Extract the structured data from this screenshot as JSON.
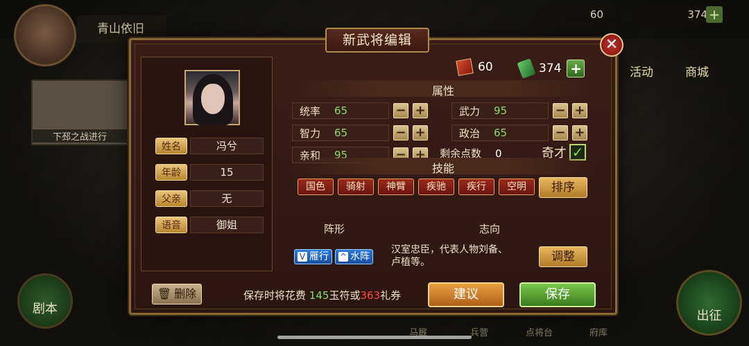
{
  "background": {
    "player_name": "青山依旧",
    "resource_a": "60",
    "resource_b": "374",
    "campaign_label": "下邳之战进行",
    "menu_activity": "活动",
    "menu_shop": "商城",
    "left_button": "剧本",
    "right_button": "出征",
    "bottom_labels": [
      "马厩",
      "兵营",
      "点将台",
      "府库"
    ]
  },
  "dialog": {
    "title": "新武将编辑",
    "close_icon": "close-icon",
    "resources": {
      "tally": "60",
      "jade": "374"
    },
    "profile": {
      "fields": [
        {
          "label": "姓名",
          "value": "冯兮"
        },
        {
          "label": "年龄",
          "value": "15"
        },
        {
          "label": "父亲",
          "value": "无"
        },
        {
          "label": "语音",
          "value": "御姐"
        }
      ]
    },
    "attributes": {
      "title": "属性",
      "stats": [
        {
          "label": "统率",
          "value": "65"
        },
        {
          "label": "武力",
          "value": "95"
        },
        {
          "label": "智力",
          "value": "65"
        },
        {
          "label": "政治",
          "value": "65"
        },
        {
          "label": "亲和",
          "value": "95"
        }
      ],
      "remaining_label": "剩余点数",
      "remaining_value": "0",
      "genius_label": "奇才"
    },
    "skills": {
      "title": "技能",
      "items": [
        "国色",
        "骑射",
        "神臂",
        "疾驰",
        "疾行",
        "空明"
      ],
      "sort_label": "排序"
    },
    "formation": {
      "title": "阵形",
      "items": [
        "雁行",
        "水阵"
      ]
    },
    "ambition": {
      "title": "志向",
      "text": "汉室忠臣，代表人物刘备、卢植等。",
      "adjust_label": "调整"
    },
    "footer": {
      "delete_label": "删除",
      "cost_prefix": "保存时将花费",
      "cost_jade": "145",
      "cost_mid": "玉符或",
      "cost_coupon": "363",
      "cost_suffix": "礼券",
      "suggest_label": "建议",
      "save_label": "保存"
    }
  }
}
